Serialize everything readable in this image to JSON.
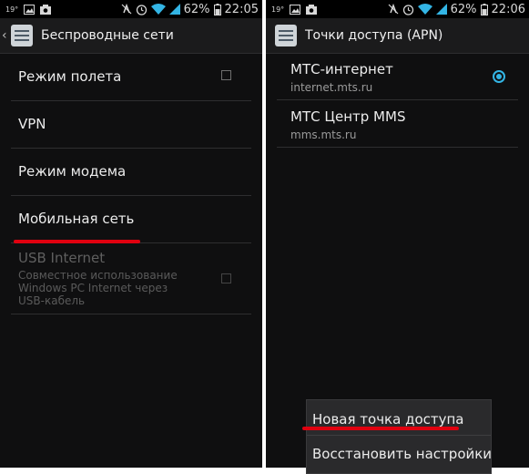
{
  "left_screen": {
    "status": {
      "temp": "19°",
      "battery_percent": "62%",
      "time": "22:05"
    },
    "title": "Беспроводные сети",
    "items": [
      {
        "label": "Режим полета"
      },
      {
        "label": "VPN"
      },
      {
        "label": "Режим модема"
      },
      {
        "label": "Мобильная сеть"
      },
      {
        "label": "USB Internet",
        "summary": "Совместное использование Windows PC Internet через USB-кабель"
      }
    ]
  },
  "right_screen": {
    "status": {
      "temp": "19°",
      "battery_percent": "62%",
      "time": "22:06"
    },
    "title": "Точки доступа (APN)",
    "apns": [
      {
        "name": "МТС-интернет",
        "apn": "internet.mts.ru",
        "selected": true
      },
      {
        "name": "МТС Центр MMS",
        "apn": "mms.mts.ru",
        "selected": false
      }
    ],
    "menu": {
      "new_apn": "Новая точка доступа",
      "reset": "Восстановить настройки"
    }
  },
  "colors": {
    "accent": "#33b5e5",
    "highlight": "#e0000f",
    "background": "#0f0f10"
  }
}
